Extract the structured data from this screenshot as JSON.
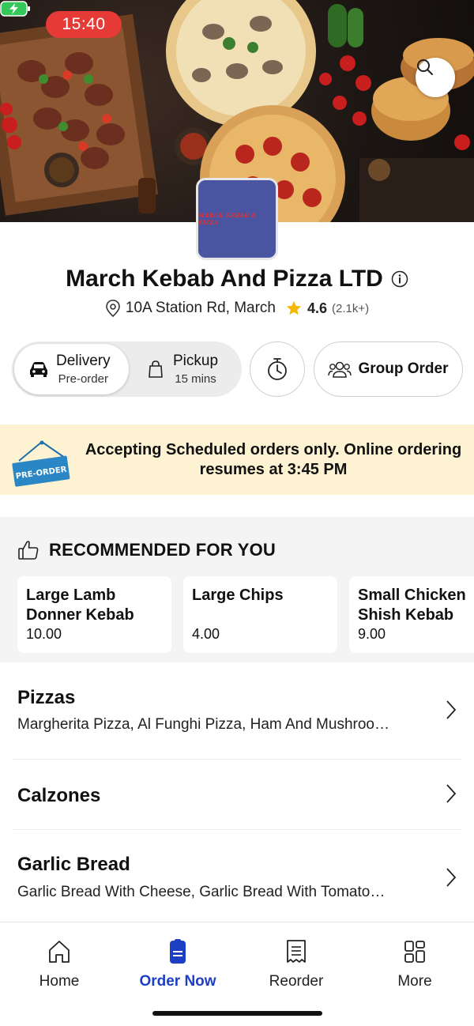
{
  "status_bar": {
    "time": "15:40"
  },
  "store": {
    "logo_text": "MARCH KEBAB & PIZZA",
    "name": "March Kebab And Pizza LTD",
    "address": "10A Station Rd, March",
    "rating": "4.6",
    "rating_count": "(2.1k+)"
  },
  "order_modes": {
    "delivery": {
      "label": "Delivery",
      "sub": "Pre-order"
    },
    "pickup": {
      "label": "Pickup",
      "sub": "15 mins"
    },
    "group_order": "Group Order"
  },
  "banner": {
    "sign_text": "PRE-ORDER",
    "message": "Accepting Scheduled orders only. Online ordering resumes at 3:45 PM"
  },
  "recommended": {
    "title": "RECOMMENDED FOR YOU",
    "items": [
      {
        "name": "Large Lamb Donner Kebab",
        "price": "10.00"
      },
      {
        "name": "Large Chips",
        "price": "4.00"
      },
      {
        "name": "Small Chicken Shish Kebab",
        "price": "9.00"
      }
    ]
  },
  "categories": [
    {
      "title": "Pizzas",
      "subtitle": "Margherita Pizza, Al Funghi Pizza, Ham And Mushroo…"
    },
    {
      "title": "Calzones",
      "subtitle": ""
    },
    {
      "title": "Garlic Bread",
      "subtitle": "Garlic Bread With Cheese, Garlic Bread With Tomato…"
    }
  ],
  "bottom_nav": [
    {
      "label": "Home",
      "icon": "home-icon"
    },
    {
      "label": "Order Now",
      "icon": "order-icon",
      "active": true
    },
    {
      "label": "Reorder",
      "icon": "receipt-icon"
    },
    {
      "label": "More",
      "icon": "grid-icon"
    }
  ],
  "colors": {
    "status_pill": "#e53a35",
    "active_nav": "#1c3fc3",
    "banner_bg": "#fdf3d2",
    "star": "#f5b800",
    "logo_bg": "#4a55a2"
  }
}
